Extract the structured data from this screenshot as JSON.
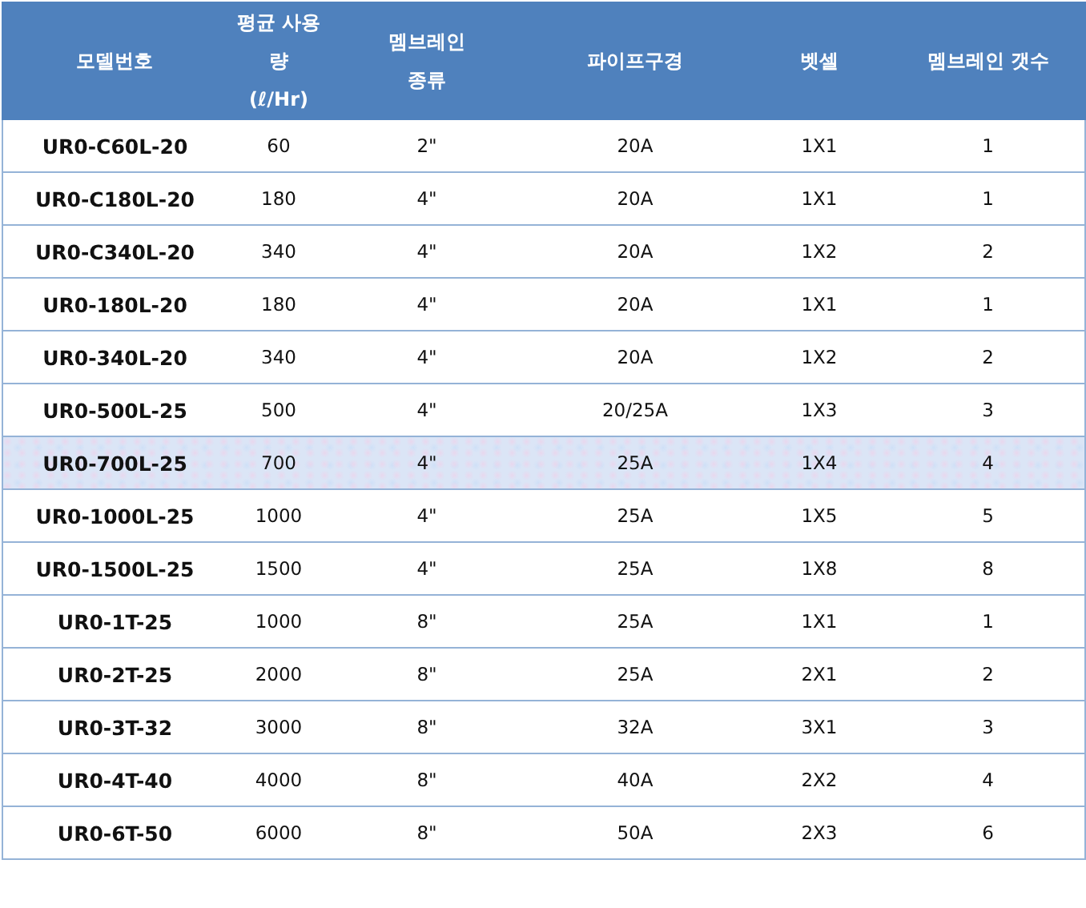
{
  "table": {
    "columns": [
      "모델번호",
      "평균 사용량\n(ℓ/Hr)",
      "멤브레인\n종류",
      "파이프구경",
      "벳셀",
      "멤브레인 갯수"
    ],
    "rows": [
      {
        "cells": [
          "UR0-C60L-20",
          "60",
          "2\"",
          "20A",
          "1X1",
          "1"
        ],
        "selected": false
      },
      {
        "cells": [
          "UR0-C180L-20",
          "180",
          "4\"",
          "20A",
          "1X1",
          "1"
        ],
        "selected": false
      },
      {
        "cells": [
          "UR0-C340L-20",
          "340",
          "4\"",
          "20A",
          "1X2",
          "2"
        ],
        "selected": false
      },
      {
        "cells": [
          "UR0-180L-20",
          "180",
          "4\"",
          "20A",
          "1X1",
          "1"
        ],
        "selected": false
      },
      {
        "cells": [
          "UR0-340L-20",
          "340",
          "4\"",
          "20A",
          "1X2",
          "2"
        ],
        "selected": false
      },
      {
        "cells": [
          "UR0-500L-25",
          "500",
          "4\"",
          "20/25A",
          "1X3",
          "3"
        ],
        "selected": false
      },
      {
        "cells": [
          "UR0-700L-25",
          "700",
          "4\"",
          "25A",
          "1X4",
          "4"
        ],
        "selected": true
      },
      {
        "cells": [
          "UR0-1000L-25",
          "1000",
          "4\"",
          "25A",
          "1X5",
          "5"
        ],
        "selected": false
      },
      {
        "cells": [
          "UR0-1500L-25",
          "1500",
          "4\"",
          "25A",
          "1X8",
          "8"
        ],
        "selected": false
      },
      {
        "cells": [
          "UR0-1T-25",
          "1000",
          "8\"",
          "25A",
          "1X1",
          "1"
        ],
        "selected": false
      },
      {
        "cells": [
          "UR0-2T-25",
          "2000",
          "8\"",
          "25A",
          "2X1",
          "2"
        ],
        "selected": false
      },
      {
        "cells": [
          "UR0-3T-32",
          "3000",
          "8\"",
          "32A",
          "3X1",
          "3"
        ],
        "selected": false
      },
      {
        "cells": [
          "UR0-4T-40",
          "4000",
          "8\"",
          "40A",
          "2X2",
          "4"
        ],
        "selected": false
      },
      {
        "cells": [
          "UR0-6T-50",
          "6000",
          "8\"",
          "50A",
          "2X3",
          "6"
        ],
        "selected": false
      }
    ]
  }
}
